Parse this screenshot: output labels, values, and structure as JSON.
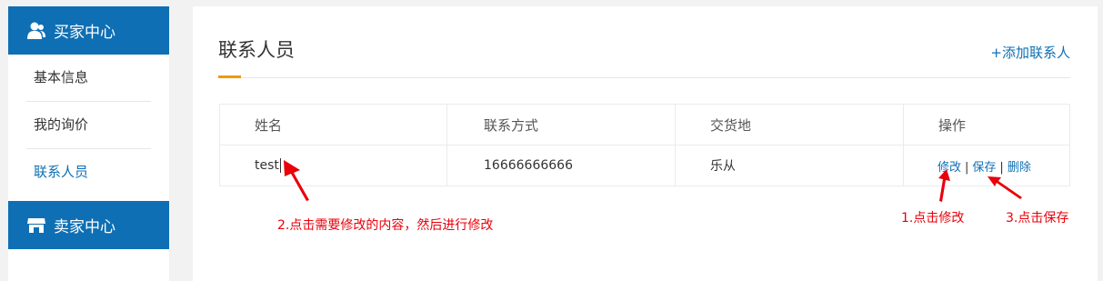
{
  "sidebar": {
    "buyer_title": "买家中心",
    "items": [
      {
        "label": "基本信息"
      },
      {
        "label": "我的询价"
      },
      {
        "label": "联系人员"
      }
    ],
    "seller_title": "卖家中心",
    "icons": {
      "buyer": "users-icon",
      "seller": "store-icon"
    }
  },
  "main": {
    "title": "联系人员",
    "add_link": "+添加联系人",
    "table": {
      "headers": [
        "姓名",
        "联系方式",
        "交货地",
        "操作"
      ],
      "rows": [
        {
          "name": "test",
          "contact": "16666666666",
          "delivery": "乐从",
          "actions": {
            "edit": "修改",
            "save": "保存",
            "delete": "删除",
            "separator": "|"
          }
        }
      ]
    }
  },
  "annotations": {
    "note1": "1.点击修改",
    "note2": "2.点击需要修改的内容，然后进行修改",
    "note3": "3.点击保存"
  },
  "colors": {
    "accent": "#0f6fb4",
    "annotation": "#e8000b",
    "title_underline": "#f39800"
  }
}
